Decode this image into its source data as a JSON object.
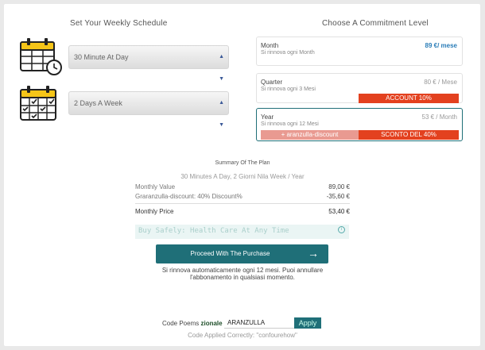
{
  "schedule": {
    "heading": "Set Your Weekly Schedule",
    "duration_value": "30 Minute At Day",
    "days_value": "2 Days A Week"
  },
  "commitment": {
    "heading": "Choose A Commitment Level",
    "plans": [
      {
        "name": "Month",
        "sub": "Si rinnova ogni Month",
        "price": "89 €/ mese"
      },
      {
        "name": "Quarter",
        "sub": "Si rinnova ogni 3 Mesi",
        "price": "80 € / Mese",
        "badge": "ACCOUNT 10%"
      },
      {
        "name": "Year",
        "sub": "Si rinnova ogni 12 Mesi",
        "price": "53 € / Month",
        "promo": "+ aranzulla-discount",
        "badge": "SCONTO DEL 40%"
      }
    ]
  },
  "summary": {
    "title": "Summary Of The Plan",
    "detail": "30 Minutes A Day, 2 Giorni Nila Week / Year",
    "monthly_value_label": "Monthly Value",
    "monthly_value": "89,00 €",
    "discount_label": "Graranzulla-discount: 40% Discount%",
    "discount_value": "-35,60 €",
    "monthly_price_label": "Monthly Price",
    "monthly_price": "53,40 €"
  },
  "safety": {
    "text": "Buy Safely: Health Care At Any Time"
  },
  "cta": {
    "label": "Proceed With The Purchase",
    "note_line1": "Si rinnova automaticamente ogni 12 mesi. Puoi annullare",
    "note_line2": "l'abbonamento in qualsiasi momento."
  },
  "promo": {
    "label": "Code Poems",
    "label_bold": "zionale",
    "code_value": "ARANZULLA",
    "apply_label": "Apply",
    "applied_text": "Code Applied Correctly: \"confourehow\""
  },
  "colors": {
    "accent": "#1f6f78",
    "sale": "#e3411f",
    "price_blue": "#2a7db8",
    "calendar_yellow": "#f5c518"
  },
  "icons": [
    "calendar-clock-icon",
    "calendar-check-icon",
    "chevron-updown-icon",
    "arrow-right-icon",
    "info-icon"
  ]
}
